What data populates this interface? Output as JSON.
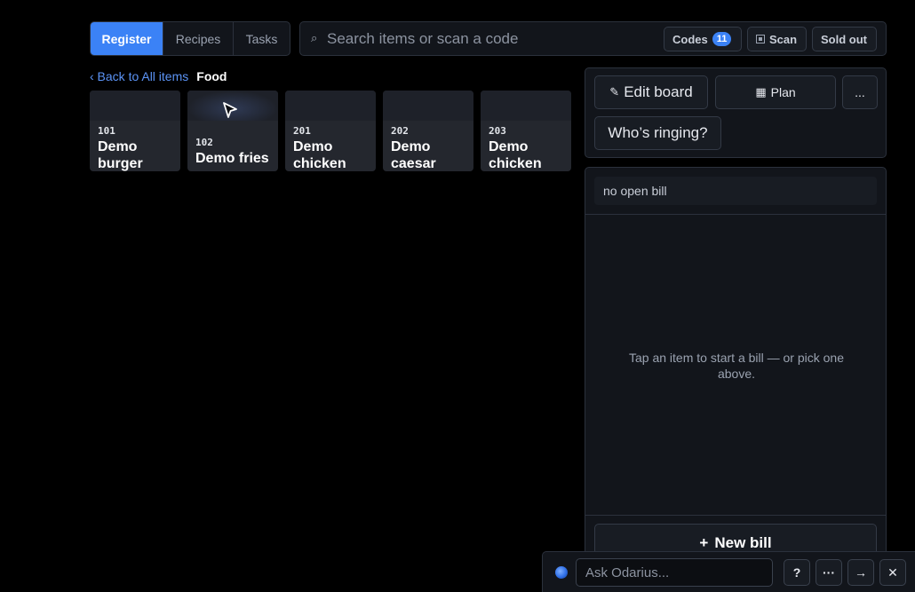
{
  "tabs": [
    {
      "label": "Register",
      "active": true
    },
    {
      "label": "Recipes",
      "active": false
    },
    {
      "label": "Tasks",
      "active": false
    }
  ],
  "search": {
    "placeholder": "Search items or scan a code",
    "icon": "search-icon",
    "codes_label": "Codes",
    "codes_count": "11",
    "scan_label": "Scan",
    "sold_out_label": "Sold out"
  },
  "breadcrumb": {
    "back": "‹ Back to All items",
    "current": "Food"
  },
  "items": [
    {
      "code": "101",
      "name": "Demo burger"
    },
    {
      "code": "102",
      "name": "Demo fries"
    },
    {
      "code": "201",
      "name": "Demo chicken"
    },
    {
      "code": "202",
      "name": "Demo caesar"
    },
    {
      "code": "203",
      "name": "Demo chicken"
    }
  ],
  "actions": {
    "edit_board": "Edit board",
    "plan": "Plan",
    "more": "...",
    "whos_ringing": "Who’s ringing?"
  },
  "bill": {
    "status": "no open bill",
    "empty_message": "Tap an item to start a bill — or pick one above.",
    "new_bill": "New bill"
  },
  "assistant": {
    "placeholder": "Ask Odarius...",
    "help": "?",
    "more": "···",
    "send": "→",
    "close": "✕"
  },
  "colors": {
    "accent": "#3b82f6",
    "background": "#000000",
    "panel": "#12151b"
  }
}
